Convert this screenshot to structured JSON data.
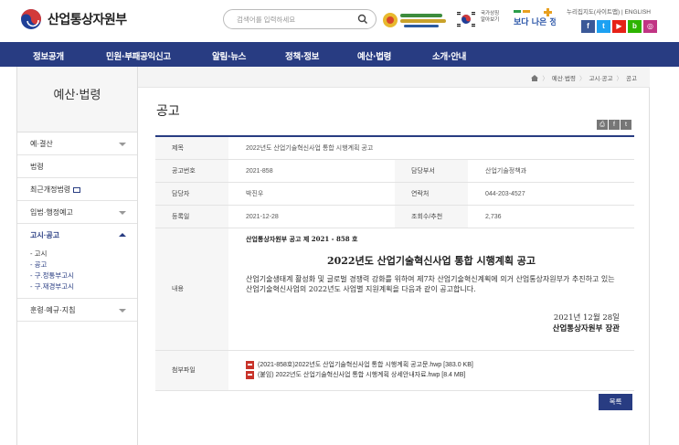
{
  "header": {
    "logo_text": "산업통상자원부",
    "search_placeholder": "검색어를 입력하세요",
    "national_text": "국가상징 알아보기",
    "banner2_text": "보다 나은 정부",
    "util_links": "누리집지도(사이트맵) | ENGLISH",
    "socials": [
      "f",
      "t",
      "▶",
      "b",
      "◎"
    ]
  },
  "nav": [
    "정보공개",
    "민원·부패공익신고",
    "알림·뉴스",
    "정책·정보",
    "예산·법령",
    "소개·안내"
  ],
  "sidebar": {
    "title": "예산·법령",
    "items": [
      "예·결산",
      "법령",
      "최근개정법령",
      "입법·행정예고",
      "고시·공고",
      "훈령·예규·지침"
    ],
    "subitems": [
      "고시",
      "공고",
      "구.정통부고시",
      "구.재경부고시"
    ]
  },
  "breadcrumb": [
    "예산·법령",
    "고시·공고",
    "공고"
  ],
  "page_title": "공고",
  "tools": [
    "⎙",
    "f",
    "t"
  ],
  "detail": {
    "subject_label": "제목",
    "subject": "2022년도 산업기술혁신사업 통합 시행계획 공고",
    "notice_no_label": "공고번호",
    "notice_no": "2021-858",
    "dept_label": "담당부서",
    "dept": "산업기술정책과",
    "person_label": "담당자",
    "person": "박진우",
    "contact_label": "연락처",
    "contact": "044-203-4527",
    "date_label": "등록일",
    "date": "2021-12-28",
    "views_label": "조회수/추천",
    "views": "2,736",
    "content_label": "내용",
    "doc_no": "산업통상자원부 공고 제 2021 - 858 호",
    "doc_title": "2022년도 산업기술혁신사업 통합 시행계획 공고",
    "doc_text": "산업기술생태계 활성화 및 글로벌 경쟁력 강화를 위하여 제7차 산업기술혁신계획에 의거 산업통상자원부가 추진하고 있는 산업기술혁신사업의 2022년도 사업별 지원계획을 다음과 같이 공고합니다.",
    "doc_date": "2021년 12월 28일",
    "doc_sign": "산업통상자원부 장관",
    "files_label": "첨부파일",
    "files": [
      "(2021-858호)2022년도 산업기술혁신사업 통합 시행계획 공고문.hwp [383.0 KB]",
      "(붙임) 2022년도 산업기술혁신사업 통합 시행계획 상세안내자료.hwp [8.4 MB]"
    ]
  },
  "list_button": "목록",
  "colors": {
    "primary": "#283c82",
    "file_icon": "#c8332a"
  }
}
